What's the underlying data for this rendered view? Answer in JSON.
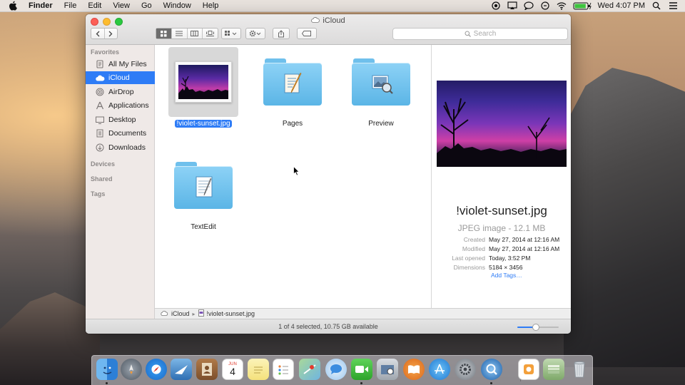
{
  "menubar": {
    "app_name": "Finder",
    "menus": [
      "File",
      "Edit",
      "View",
      "Go",
      "Window",
      "Help"
    ],
    "clock": "Wed 4:07 PM",
    "status_icons": [
      "record-icon",
      "airplay-icon",
      "messages-icon",
      "notification-icon",
      "wifi-icon",
      "battery-icon",
      "search-icon",
      "list-icon"
    ],
    "battery_level": 0.9
  },
  "window": {
    "title": "iCloud",
    "search_placeholder": "Search",
    "view_mode": "icon"
  },
  "sidebar": {
    "sections": {
      "favorites": "Favorites",
      "devices": "Devices",
      "shared": "Shared",
      "tags": "Tags"
    },
    "items": [
      {
        "label": "All My Files",
        "icon": "all-files-icon",
        "selected": false
      },
      {
        "label": "iCloud",
        "icon": "cloud-icon",
        "selected": true
      },
      {
        "label": "AirDrop",
        "icon": "airdrop-icon",
        "selected": false
      },
      {
        "label": "Applications",
        "icon": "applications-icon",
        "selected": false
      },
      {
        "label": "Desktop",
        "icon": "desktop-icon",
        "selected": false
      },
      {
        "label": "Documents",
        "icon": "documents-icon",
        "selected": false
      },
      {
        "label": "Downloads",
        "icon": "downloads-icon",
        "selected": false
      }
    ]
  },
  "files": [
    {
      "name": "!violet-sunset.jpg",
      "kind": "image",
      "selected": true
    },
    {
      "name": "Pages",
      "kind": "folder",
      "emblem": "pages-icon"
    },
    {
      "name": "Preview",
      "kind": "folder",
      "emblem": "preview-icon"
    },
    {
      "name": "TextEdit",
      "kind": "folder",
      "emblem": "textedit-icon"
    }
  ],
  "preview": {
    "name": "!violet-sunset.jpg",
    "kind": "JPEG image - 12.1 MB",
    "meta": [
      {
        "key": "Created",
        "value": "May 27, 2014 at 12:16 AM"
      },
      {
        "key": "Modified",
        "value": "May 27, 2014 at 12:16 AM"
      },
      {
        "key": "Last opened",
        "value": "Today, 3:52 PM"
      },
      {
        "key": "Dimensions",
        "value": "5184 × 3456"
      }
    ],
    "add_tags": "Add Tags…"
  },
  "pathbar": {
    "segments": [
      "iCloud",
      "!violet-sunset.jpg"
    ]
  },
  "statusbar": {
    "text": "1 of 4 selected, 10.75 GB available",
    "zoom_level": 0.45
  },
  "dock": {
    "apps": [
      "finder-icon",
      "launchpad-icon",
      "safari-icon",
      "mail-icon",
      "contacts-icon",
      "calendar-icon",
      "notes-icon",
      "reminders-icon",
      "maps-icon",
      "messages-icon",
      "facetime-icon",
      "photo-booth-icon",
      "ibooks-icon",
      "app-store-icon",
      "system-preferences-icon",
      "quicktime-icon"
    ],
    "calendar_month": "JUN",
    "calendar_day": "4",
    "right_items": [
      "downloads-stack-icon",
      "documents-stack-icon",
      "trash-icon"
    ]
  },
  "colors": {
    "accent": "#2e7cf6",
    "folder_blue": "#6fc0ec"
  }
}
